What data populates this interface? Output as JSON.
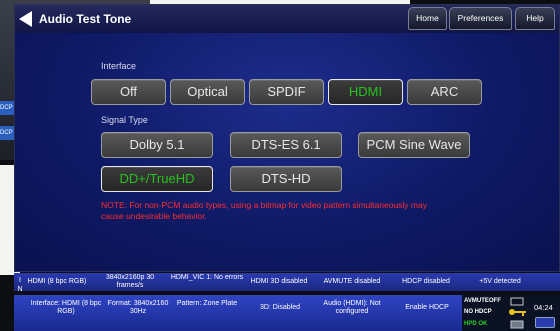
{
  "background": {
    "tags": [
      "DCP",
      "DCP"
    ]
  },
  "header": {
    "title": "Audio Test Tone",
    "tabs": [
      "Home",
      "Preferences",
      "Help"
    ]
  },
  "interface": {
    "label": "Interface",
    "options": [
      "Off",
      "Optical",
      "SPDIF",
      "HDMI",
      "ARC"
    ],
    "selected": "HDMI"
  },
  "signal_type": {
    "label": "Signal Type",
    "options": [
      "Dolby 5.1",
      "DTS-ES 6.1",
      "PCM Sine Wave",
      "DD+/TrueHD",
      "DTS-HD"
    ],
    "selected": "DD+/TrueHD"
  },
  "note": "NOTE: For non-PCM audio types, using a bitmap for video pattern simultaneously may cause undesirable behavior.",
  "status_bar_top": {
    "cells": [
      "HDMI (8 bpc RGB)",
      "3840x2160p 30 frames/s",
      "HDMI_VIC 1: No errors",
      "HDMI 3D disabled",
      "AVMUTE disabled",
      "HDCP disabled",
      "+5V detected"
    ]
  },
  "status_bar_bottom": {
    "side_letters": [
      "I",
      "N",
      "O",
      "U",
      "T"
    ],
    "cells": [
      "Interface: HDMI (8 bpc RGB)",
      "Format: 3840x2160 30Hz",
      "Pattern: Zone Plate",
      "3D: Disabled",
      "Audio (HDMI): Not configured",
      "Enable HDCP"
    ]
  },
  "indicators": {
    "avmute": "AVMUTEOFF",
    "hdcp": "NO HDCP",
    "hpd": "HPD OK",
    "time": "04:24",
    "colors": {
      "avmute": "#ffffff",
      "hdcp": "#ffffff",
      "hpd": "#2bd12b",
      "key": "#e8c21b"
    }
  },
  "colors": {
    "selected_text": "#27c21e",
    "note_text": "#ff2d2d",
    "window_bg": "#0f1a66",
    "status_bar": "#2a3bb0"
  }
}
